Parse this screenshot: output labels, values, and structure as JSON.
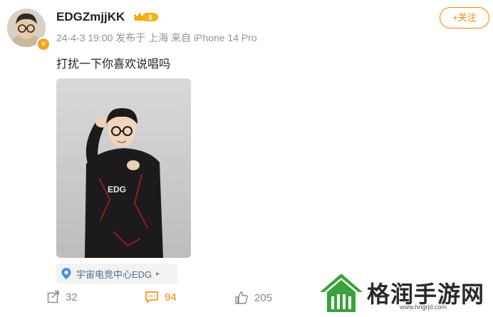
{
  "post": {
    "username": "EDGZmjjKK",
    "rank_badge": "Ⅱ",
    "meta": "24-4-3 19:00 发布于 上海 来自 iPhone 14 Pro",
    "follow_label": "+关注",
    "text": "打扰一下你喜欢说唱吗",
    "location": "宇宙电竞中心EDG",
    "stats": {
      "reposts": "32",
      "comments": "94",
      "likes": "205"
    }
  },
  "watermark": {
    "text": "格润手游网",
    "url": "www.hngrjd.com"
  },
  "colors": {
    "accent": "#ff8200",
    "link": "#4d6e91",
    "watermark_green": "#3aa23a"
  },
  "icons": [
    "verified-badge-icon",
    "crown-rank-icon",
    "location-pin-icon",
    "chevron-right-icon",
    "repost-icon",
    "comment-icon",
    "like-icon",
    "house-logo-icon"
  ]
}
